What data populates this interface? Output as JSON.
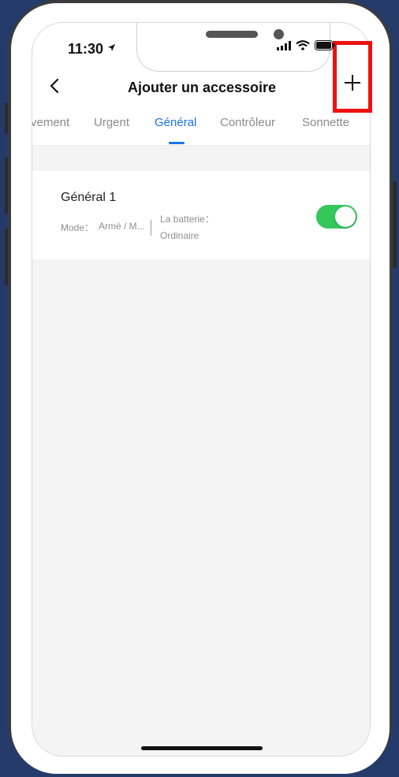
{
  "status_bar": {
    "time": "11:30"
  },
  "header": {
    "title": "Ajouter un accessoire"
  },
  "tabs": [
    {
      "label": "vement"
    },
    {
      "label": "Urgent"
    },
    {
      "label": "Général",
      "active": true
    },
    {
      "label": "Contrôleur"
    },
    {
      "label": "Sonnette"
    }
  ],
  "accessory": {
    "name": "Général 1",
    "mode_label": "Mode：",
    "mode_value": "Armé / M...",
    "battery_label": "La batterie：",
    "battery_value": "Ordinaire",
    "enabled": true
  },
  "colors": {
    "accent": "#1a73e8",
    "toggle_on": "#34c759",
    "highlight": "#ee1111",
    "background": "#243b6a"
  },
  "icons": [
    "location-arrow-icon",
    "signal-icon",
    "wifi-icon",
    "battery-icon",
    "back-chevron-icon",
    "plus-icon"
  ]
}
